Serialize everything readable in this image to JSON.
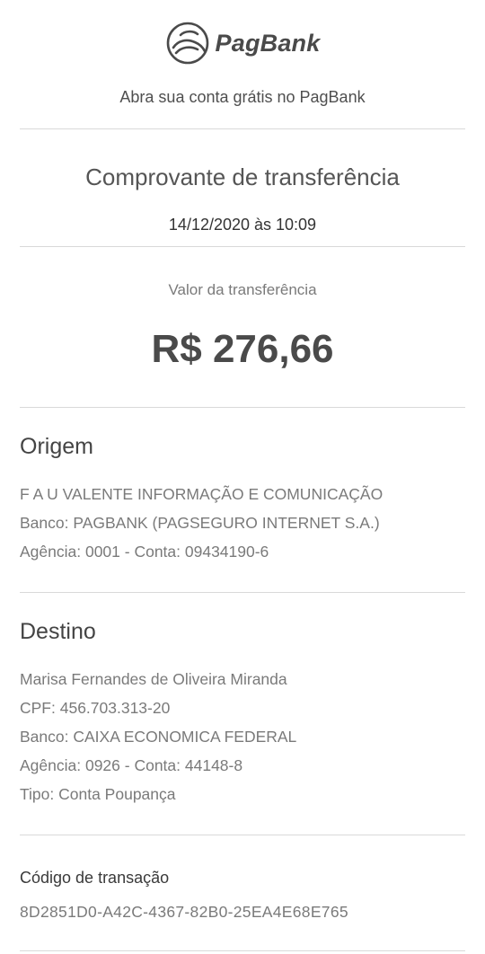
{
  "header": {
    "brand": "PagBank",
    "tagline": "Abra sua conta grátis no PagBank"
  },
  "receipt": {
    "title": "Comprovante de transferência",
    "datetime": "14/12/2020 às 10:09",
    "amount_label": "Valor da transferência",
    "amount": "R$ 276,66"
  },
  "origin": {
    "heading": "Origem",
    "lines": [
      "F A U VALENTE INFORMAÇÃO E COMUNICAÇÃO",
      "Banco: PAGBANK (PAGSEGURO INTERNET S.A.)",
      "Agência: 0001 - Conta: 09434190-6"
    ]
  },
  "destination": {
    "heading": "Destino",
    "lines": [
      "Marisa Fernandes de Oliveira Miranda",
      "CPF: 456.703.313-20",
      "Banco: CAIXA ECONOMICA FEDERAL",
      "Agência: 0926 - Conta: 44148-8",
      "Tipo: Conta Poupança"
    ]
  },
  "transaction": {
    "label": "Código de transação",
    "code": "8D2851D0-A42C-4367-82B0-25EA4E68E765"
  },
  "colors": {
    "brand_gray": "#4a4a4a",
    "divider": "#d9d9d9",
    "muted_text": "#7a7a7a"
  },
  "icons": {
    "logo": "pagbank-logo-icon"
  }
}
